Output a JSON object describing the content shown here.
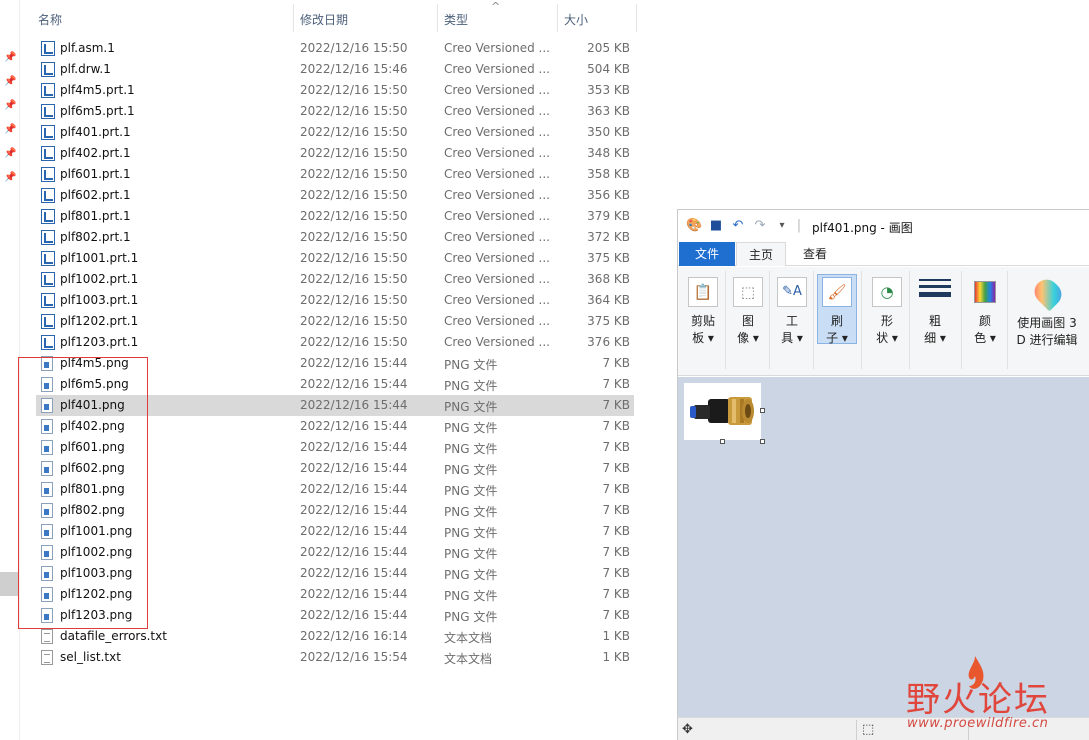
{
  "explorer": {
    "columns": {
      "name": "名称",
      "modified": "修改日期",
      "type": "类型",
      "size": "大小"
    },
    "files": [
      {
        "name": "plf.asm.1",
        "modified": "2022/12/16 15:50",
        "type": "Creo Versioned ...",
        "size": "205 KB",
        "icon": "creo-file-icon"
      },
      {
        "name": "plf.drw.1",
        "modified": "2022/12/16 15:46",
        "type": "Creo Versioned ...",
        "size": "504 KB",
        "icon": "creo-file-icon"
      },
      {
        "name": "plf4m5.prt.1",
        "modified": "2022/12/16 15:50",
        "type": "Creo Versioned ...",
        "size": "353 KB",
        "icon": "creo-file-icon"
      },
      {
        "name": "plf6m5.prt.1",
        "modified": "2022/12/16 15:50",
        "type": "Creo Versioned ...",
        "size": "363 KB",
        "icon": "creo-file-icon"
      },
      {
        "name": "plf401.prt.1",
        "modified": "2022/12/16 15:50",
        "type": "Creo Versioned ...",
        "size": "350 KB",
        "icon": "creo-file-icon"
      },
      {
        "name": "plf402.prt.1",
        "modified": "2022/12/16 15:50",
        "type": "Creo Versioned ...",
        "size": "348 KB",
        "icon": "creo-file-icon"
      },
      {
        "name": "plf601.prt.1",
        "modified": "2022/12/16 15:50",
        "type": "Creo Versioned ...",
        "size": "358 KB",
        "icon": "creo-file-icon"
      },
      {
        "name": "plf602.prt.1",
        "modified": "2022/12/16 15:50",
        "type": "Creo Versioned ...",
        "size": "356 KB",
        "icon": "creo-file-icon"
      },
      {
        "name": "plf801.prt.1",
        "modified": "2022/12/16 15:50",
        "type": "Creo Versioned ...",
        "size": "379 KB",
        "icon": "creo-file-icon"
      },
      {
        "name": "plf802.prt.1",
        "modified": "2022/12/16 15:50",
        "type": "Creo Versioned ...",
        "size": "372 KB",
        "icon": "creo-file-icon"
      },
      {
        "name": "plf1001.prt.1",
        "modified": "2022/12/16 15:50",
        "type": "Creo Versioned ...",
        "size": "375 KB",
        "icon": "creo-file-icon"
      },
      {
        "name": "plf1002.prt.1",
        "modified": "2022/12/16 15:50",
        "type": "Creo Versioned ...",
        "size": "368 KB",
        "icon": "creo-file-icon"
      },
      {
        "name": "plf1003.prt.1",
        "modified": "2022/12/16 15:50",
        "type": "Creo Versioned ...",
        "size": "364 KB",
        "icon": "creo-file-icon"
      },
      {
        "name": "plf1202.prt.1",
        "modified": "2022/12/16 15:50",
        "type": "Creo Versioned ...",
        "size": "375 KB",
        "icon": "creo-file-icon"
      },
      {
        "name": "plf1203.prt.1",
        "modified": "2022/12/16 15:50",
        "type": "Creo Versioned ...",
        "size": "376 KB",
        "icon": "creo-file-icon"
      },
      {
        "name": "plf4m5.png",
        "modified": "2022/12/16 15:44",
        "type": "PNG 文件",
        "size": "7 KB",
        "icon": "png-file-icon"
      },
      {
        "name": "plf6m5.png",
        "modified": "2022/12/16 15:44",
        "type": "PNG 文件",
        "size": "7 KB",
        "icon": "png-file-icon"
      },
      {
        "name": "plf401.png",
        "modified": "2022/12/16 15:44",
        "type": "PNG 文件",
        "size": "7 KB",
        "icon": "png-file-icon",
        "selected": true
      },
      {
        "name": "plf402.png",
        "modified": "2022/12/16 15:44",
        "type": "PNG 文件",
        "size": "7 KB",
        "icon": "png-file-icon"
      },
      {
        "name": "plf601.png",
        "modified": "2022/12/16 15:44",
        "type": "PNG 文件",
        "size": "7 KB",
        "icon": "png-file-icon"
      },
      {
        "name": "plf602.png",
        "modified": "2022/12/16 15:44",
        "type": "PNG 文件",
        "size": "7 KB",
        "icon": "png-file-icon"
      },
      {
        "name": "plf801.png",
        "modified": "2022/12/16 15:44",
        "type": "PNG 文件",
        "size": "7 KB",
        "icon": "png-file-icon"
      },
      {
        "name": "plf802.png",
        "modified": "2022/12/16 15:44",
        "type": "PNG 文件",
        "size": "7 KB",
        "icon": "png-file-icon"
      },
      {
        "name": "plf1001.png",
        "modified": "2022/12/16 15:44",
        "type": "PNG 文件",
        "size": "7 KB",
        "icon": "png-file-icon"
      },
      {
        "name": "plf1002.png",
        "modified": "2022/12/16 15:44",
        "type": "PNG 文件",
        "size": "7 KB",
        "icon": "png-file-icon"
      },
      {
        "name": "plf1003.png",
        "modified": "2022/12/16 15:44",
        "type": "PNG 文件",
        "size": "7 KB",
        "icon": "png-file-icon"
      },
      {
        "name": "plf1202.png",
        "modified": "2022/12/16 15:44",
        "type": "PNG 文件",
        "size": "7 KB",
        "icon": "png-file-icon"
      },
      {
        "name": "plf1203.png",
        "modified": "2022/12/16 15:44",
        "type": "PNG 文件",
        "size": "7 KB",
        "icon": "png-file-icon"
      },
      {
        "name": "datafile_errors.txt",
        "modified": "2022/12/16 16:14",
        "type": "文本文档",
        "size": "1 KB",
        "icon": "text-file-icon"
      },
      {
        "name": "sel_list.txt",
        "modified": "2022/12/16 15:54",
        "type": "文本文档",
        "size": "1 KB",
        "icon": "text-file-icon"
      }
    ]
  },
  "paint": {
    "title": "plf401.png - 画图",
    "tabs": {
      "file": "文件",
      "home": "主页",
      "view": "查看"
    },
    "tools": {
      "clipboard": {
        "line1": "剪贴",
        "line2": "板 ▾"
      },
      "image": {
        "line1": "图",
        "line2": "像 ▾"
      },
      "tools": {
        "line1": "工",
        "line2": "具 ▾"
      },
      "brush": {
        "line1": "刷",
        "line2": "子 ▾"
      },
      "shapes": {
        "line1": "形",
        "line2": "状 ▾"
      },
      "size": {
        "line1": "粗",
        "line2": "细 ▾"
      },
      "colors": {
        "line1": "颜",
        "line2": "色 ▾"
      },
      "paint3d": {
        "line1": "使用画图 3",
        "line2": "D 进行编辑"
      }
    }
  },
  "watermark": {
    "text": "野火论坛",
    "url": "www.proewildfire.cn"
  },
  "colors": {
    "accent": "#1e6fd0",
    "selection": "#d9d9d9",
    "highlight_box": "#e03b3b",
    "canvas_bg": "#cbd5e4",
    "watermark": "#e0463b"
  }
}
